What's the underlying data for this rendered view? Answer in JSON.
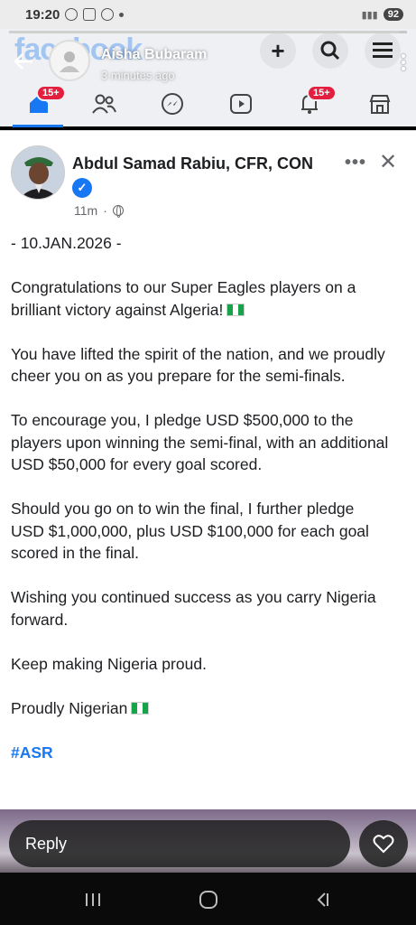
{
  "status_bar": {
    "time": "19:20",
    "battery": "92"
  },
  "story": {
    "user_name": "Aisha Bubaram",
    "time_ago": "3 minutes ago"
  },
  "fb_header": {
    "logo_text": "facebook"
  },
  "nav": {
    "home_badge": "15+",
    "notifications_badge": "15+"
  },
  "post": {
    "author": "Abdul Samad Rabiu, CFR, CON",
    "time": "11m",
    "more": "•••",
    "close": "✕",
    "paragraphs": [
      "- 10.JAN.2026 -",
      "Congratulations to our Super Eagles players on a brilliant victory against Algeria!",
      "You have lifted the spirit of the nation, and we proudly cheer you on as you prepare for the semi-finals.",
      "To encourage you, I pledge USD $500,000 to the players upon winning the semi-final, with an additional USD $50,000 for every goal scored.",
      "Should you go on to win the final, I further pledge\nUSD $1,000,000, plus USD $100,000 for each goal scored in the final.",
      "Wishing you continued success as you carry Nigeria forward.",
      "Keep making Nigeria proud.",
      "Proudly Nigerian",
      "#ASR"
    ]
  },
  "reply": {
    "placeholder": "Reply"
  },
  "colors": {
    "facebook_blue": "#1877f2",
    "badge_red": "#e41e3f",
    "nigeria_green": "#17a34a"
  },
  "icons": [
    "back-arrow-icon",
    "plus-icon",
    "search-icon",
    "menu-icon",
    "home-icon",
    "friends-icon",
    "messenger-icon",
    "video-icon",
    "bell-icon",
    "marketplace-icon",
    "globe-icon",
    "heart-icon",
    "verified-icon",
    "nigeria-flag-icon"
  ]
}
